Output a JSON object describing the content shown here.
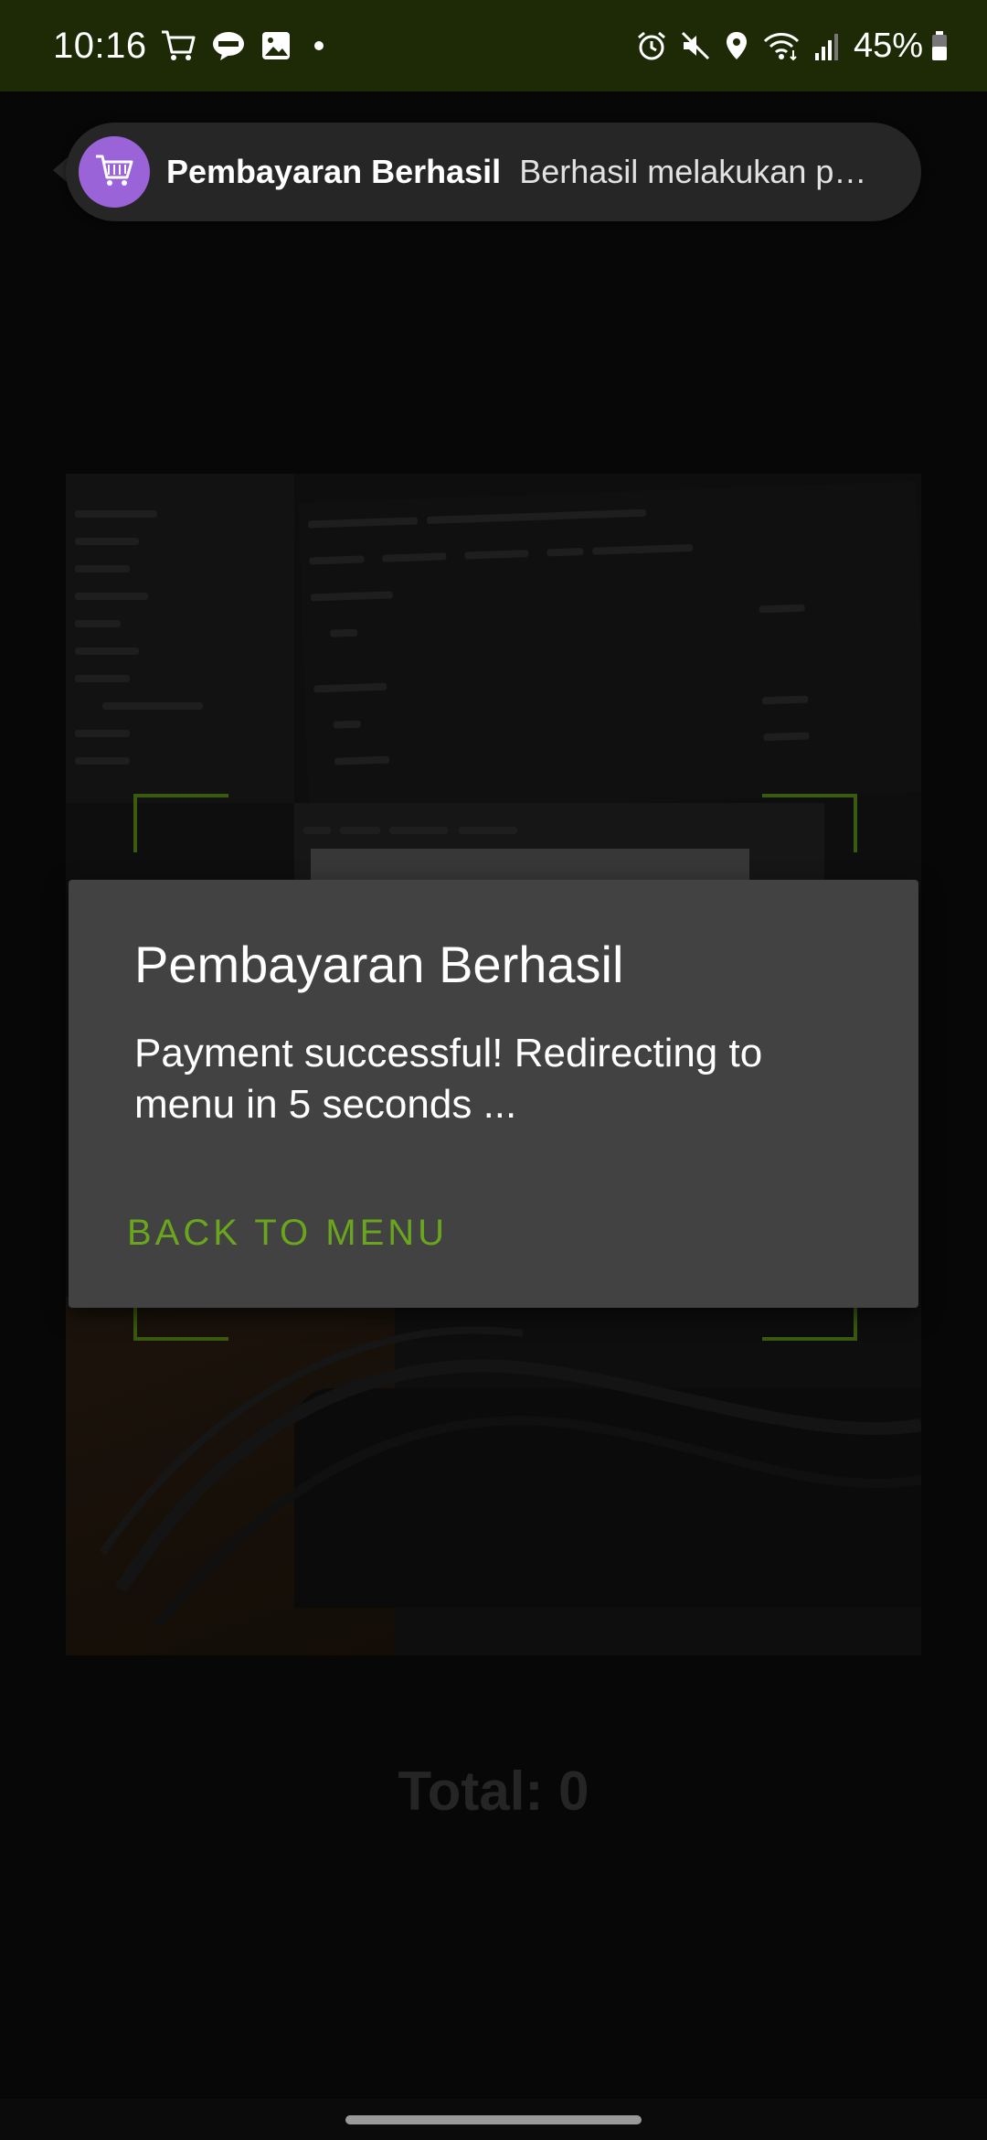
{
  "status_bar": {
    "time": "10:16",
    "battery_text": "45%",
    "left_icons": [
      "cart-icon",
      "line-icon",
      "image-icon",
      "dot-icon"
    ],
    "right_icons": [
      "alarm-icon",
      "mute-icon",
      "location-icon",
      "wifi-icon",
      "signal-icon",
      "battery-icon"
    ]
  },
  "notification": {
    "app_icon": "cart-icon",
    "title": "Pembayaran Berhasil",
    "text": "Berhasil melakukan p…",
    "icon_color": "#9a63d8"
  },
  "dialog": {
    "title": "Pembayaran Berhasil",
    "message": "Payment successful! Redirecting to menu in 5 seconds ...",
    "button_label": "BACK TO MENU",
    "button_color": "#6aa51e"
  },
  "scanner": {
    "frame_color": "#5a8a18"
  },
  "total": {
    "text": "Total: 0"
  }
}
